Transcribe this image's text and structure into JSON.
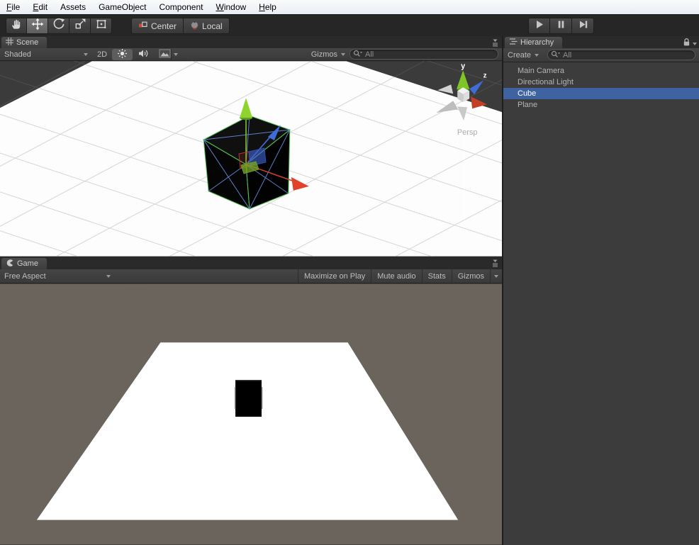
{
  "menu": {
    "items": [
      "File",
      "Edit",
      "Assets",
      "GameObject",
      "Component",
      "Window",
      "Help"
    ]
  },
  "toolbar": {
    "center_label": "Center",
    "local_label": "Local",
    "tools": [
      "hand-tool",
      "move-tool",
      "rotate-tool",
      "scale-tool",
      "rect-tool"
    ],
    "active_tool": "move-tool",
    "playback": [
      "play",
      "pause",
      "step"
    ]
  },
  "scene": {
    "tab_label": "Scene",
    "shaded_label": "Shaded",
    "btn_2d": "2D",
    "gizmos_label": "Gizmos",
    "search_text": "All",
    "persp_label": "Persp",
    "axis_y": "y",
    "axis_z": "z"
  },
  "game": {
    "tab_label": "Game",
    "aspect_label": "Free Aspect",
    "maximize_label": "Maximize on Play",
    "mute_label": "Mute audio",
    "stats_label": "Stats",
    "gizmos_label": "Gizmos"
  },
  "hierarchy": {
    "tab_label": "Hierarchy",
    "create_label": "Create",
    "search_text": "All",
    "items": [
      {
        "name": "Main Camera",
        "selected": false
      },
      {
        "name": "Directional Light",
        "selected": false
      },
      {
        "name": "Cube",
        "selected": true
      },
      {
        "name": "Plane",
        "selected": false
      }
    ]
  },
  "icons": {
    "tools": [
      "hand-icon",
      "move-icon",
      "rotate-icon",
      "scale-icon",
      "rect-icon"
    ],
    "pivot": [
      "center-pivot-icon",
      "local-space-icon"
    ],
    "playback": [
      "play-icon",
      "pause-icon",
      "step-icon"
    ],
    "scene_toolbar": [
      "sun-icon",
      "speaker-icon",
      "image-icon",
      "magnifier-icon"
    ],
    "tabs": [
      "grid-icon",
      "pacman-icon",
      "list-icon"
    ],
    "misc": [
      "lock-icon",
      "pane-menu-icon",
      "chevron-down-icon"
    ]
  },
  "colors": {
    "selection_blue": "#3f63a0",
    "scene_bg": "#3b3b3b",
    "game_bg": "#6a645d",
    "axis_green": "#7ec626",
    "axis_red": "#c9402a",
    "axis_blue": "#3f6cd6",
    "menubar_bg": "#eef1f6",
    "dark_ui": "#3c3c3c"
  }
}
